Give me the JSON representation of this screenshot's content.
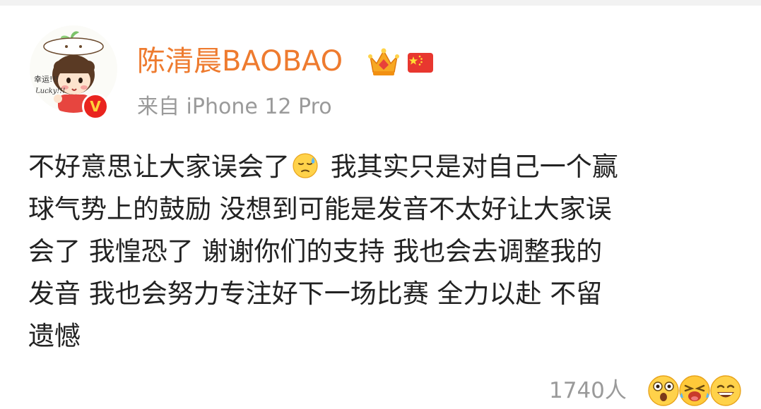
{
  "user": {
    "name": "陈清晨BAOBAO",
    "avatar_text_1": "幸运!!!",
    "avatar_text_2": "Lucky!!!",
    "verified_badge": "V"
  },
  "source": {
    "text": "来自 iPhone 12 Pro"
  },
  "post": {
    "line1_before_emoji": "不好意思让大家误会了",
    "line1_after_emoji": " 我其实只是对自己一个赢",
    "line2": "球气势上的鼓励 没想到可能是发音不太好让大家误",
    "line3": "会了 我惶恐了 谢谢你们的支持 我也会去调整我的",
    "line4": "发音 我也会努力专注好下一场比赛 全力以赴 不留",
    "line5": "遗憾"
  },
  "footer": {
    "like_count": "1740人"
  },
  "icons": {
    "crown": "crown-icon",
    "flag": "china-flag-icon",
    "sweat": "sweat-face-emoji-icon",
    "reaction_1": "surprised-face-icon",
    "reaction_2": "laughing-face-icon",
    "reaction_3": "grinning-face-icon"
  },
  "colors": {
    "username": "#ee7b2f",
    "meta_text": "#9a9a9a",
    "body_text": "#222222",
    "verified_red": "#e9241e",
    "verified_gold": "#ffd23a"
  }
}
